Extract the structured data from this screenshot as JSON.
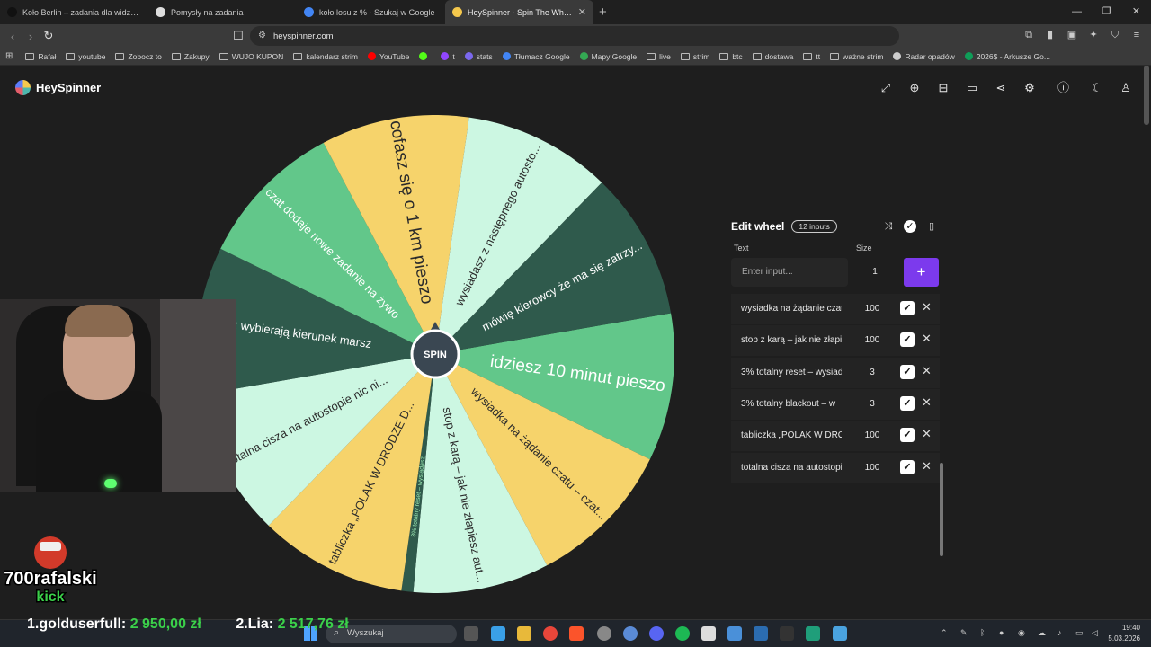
{
  "tabs": [
    {
      "title": "Koło Berlin – zadania dla widzów - Google",
      "color": "#111111",
      "active": false
    },
    {
      "title": "Pomysły na zadania",
      "color": "#dddddd",
      "active": false
    },
    {
      "title": "koło losu z % - Szukaj w Google",
      "color": "#4285f4",
      "active": false
    },
    {
      "title": "HeySpinner - Spin The Wheel",
      "color": "#f5c84c",
      "active": true
    }
  ],
  "address": "heyspinner.com",
  "bookmarks": [
    "Rafał",
    "youtube",
    "Zobocz to",
    "Zakupy",
    "WUJO KUPON",
    "kalendarz strim",
    "YouTube",
    "",
    "t",
    "stats",
    "Tłumacz Google",
    "Mapy Google",
    "live",
    "strim",
    "btc",
    "dostawa",
    "tt",
    "ważne strim",
    "Radar opadów",
    "2026$ - Arkusze Go..."
  ],
  "app": {
    "brand": "HeySpinner"
  },
  "wheel": {
    "center_label": "SPIN",
    "segments": [
      {
        "label": "idziesz 10 minut pieszo",
        "color": "#62c78a",
        "text_color": "#ffffff",
        "size": 1
      },
      {
        "label": "wysiadka na żądanie czatu – czat...",
        "color": "#f6d36b",
        "text_color": "#2b2b2b",
        "size": 1
      },
      {
        "label": "stop z karą – jak nie złapiesz aut...",
        "color": "#ccf7e2",
        "text_color": "#2b2b2b",
        "size": 0.92
      },
      {
        "label": "3% totalny reset – wysiadasz",
        "color": "#2f5a4c",
        "text_color": "#9be8b2",
        "size": 0.08
      },
      {
        "label": "tabliczka „POLAK W DRODZE D...",
        "color": "#f6d36b",
        "text_color": "#2b2b2b",
        "size": 1
      },
      {
        "label": "totalna cisza na autostopie nic ni...",
        "color": "#ccf7e2",
        "text_color": "#2b2b2b",
        "size": 1
      },
      {
        "label": "widz wybierają kierunek marsz",
        "color": "#2f5a4c",
        "text_color": "#ffffff",
        "size": 1
      },
      {
        "label": "czat dodaje nowe zadanie na żywo",
        "color": "#62c78a",
        "text_color": "#ffffff",
        "size": 1
      },
      {
        "label": "cofasz się o 1 km pieszo",
        "color": "#f6d36b",
        "text_color": "#2b2b2b",
        "size": 1
      },
      {
        "label": "wysiadasz z następnego autosto...",
        "color": "#ccf7e2",
        "text_color": "#2b2b2b",
        "size": 1
      },
      {
        "label": "mówię kierowcy że ma się zatrzy...",
        "color": "#2f5a4c",
        "text_color": "#ffffff",
        "size": 1
      }
    ]
  },
  "panel": {
    "title": "Edit wheel",
    "badge": "12 inputs",
    "col_text": "Text",
    "col_size": "Size",
    "input_placeholder": "Enter input...",
    "input_size": "1",
    "rows": [
      {
        "text": "wysiadka na żądanie czatu",
        "size": "100"
      },
      {
        "text": "stop z karą – jak nie złapiesz",
        "size": "100"
      },
      {
        "text": "3% totalny reset – wysiadasz",
        "size": "3"
      },
      {
        "text": "3% totalny blackout – w",
        "size": "3"
      },
      {
        "text": "tabliczka „POLAK W DROGĘ",
        "size": "100"
      },
      {
        "text": "totalna cisza na autostopie",
        "size": "100"
      }
    ]
  },
  "overlay": {
    "streamer": "700rafalski",
    "platform": "kick",
    "ticker_name_1": "1.golduserfull:",
    "ticker_amt_1": "2 950,00 zł",
    "ticker_name_2": "2.Lia:",
    "ticker_amt_2": "2 517,76 zł"
  },
  "taskbar": {
    "search": "Wyszukaj",
    "time": "19:40",
    "date": "5.03.2026"
  }
}
